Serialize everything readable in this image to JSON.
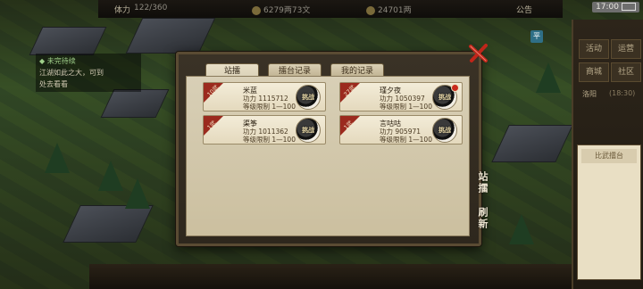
{
  "hud": {
    "stamina_label": "体力",
    "stamina_value": "122/360",
    "silver": "6279两73文",
    "copper": "24701两",
    "announcement": "公告",
    "time": "17:00",
    "quick_btn": "平"
  },
  "left_notice": {
    "title": "◆ 未完待续",
    "line1": "江湖如此之大，可到",
    "line2": "处去看看"
  },
  "right_panel": {
    "btn1": "活动",
    "btn2": "运营",
    "btn3": "商城",
    "btn4": "社区",
    "text1": "洛阳",
    "text2": "(18:30)",
    "leaderboard": "比武擂台"
  },
  "dialog": {
    "tabs": [
      "站擂",
      "擂台记录",
      "我的记录"
    ],
    "active_tab": 0,
    "power_prefix": "功力",
    "level_limit": "等级限制 1—100",
    "challenge_glyph": "挑战",
    "cards": [
      {
        "rank": "10武",
        "name": "米蓝",
        "power": "1115712",
        "has_dot": false
      },
      {
        "rank": "27武",
        "name": "瑾夕夜",
        "power": "1050397",
        "has_dot": true
      },
      {
        "rank": "1武",
        "name": "渠筝",
        "power": "1011362",
        "has_dot": false
      },
      {
        "rank": "1武",
        "name": "言咕咕",
        "power": "905971",
        "has_dot": false
      }
    ]
  },
  "side_buttons": {
    "stand": "站擂",
    "refresh": "刷新"
  },
  "colors": {
    "ribbon": "#9b2a1e",
    "close": "#c0261a",
    "parchment": "#d8cfb6"
  }
}
